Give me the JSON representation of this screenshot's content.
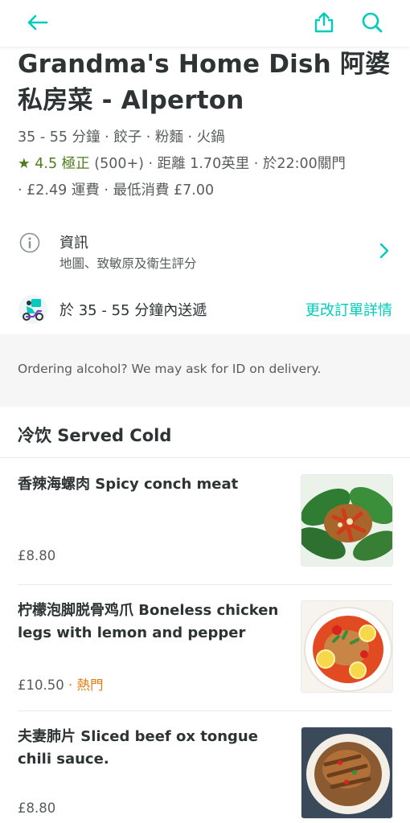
{
  "nav": {
    "back_icon": "arrow-left-icon",
    "share_icon": "share-icon",
    "search_icon": "search-icon",
    "accent": "#00ccbc"
  },
  "restaurant": {
    "title_line1": "Grandma's Home Dish 阿婆",
    "title_line2": "私房菜 - Alperton",
    "line1": "35 - 55 分鐘 · 餃子 · 粉麵 · 火鍋",
    "rating": "4.5 極正",
    "line2_rest": "(500+) · 距離 1.70英里 · 於22:00關門",
    "line3": "· £2.49 運費 · 最低消費 £7.00"
  },
  "info": {
    "title": "資訊",
    "subtitle": "地圖、致敏原及衛生評分"
  },
  "delivery": {
    "text": "於 35 - 55 分鐘內送遞",
    "link": "更改訂單詳情"
  },
  "notice": {
    "text": "Ordering alcohol? We may ask for ID on delivery."
  },
  "section": {
    "title": "冷饮 Served Cold"
  },
  "items": [
    {
      "name": "香辣海螺肉 Spicy conch meat",
      "price": "£8.80",
      "tag": ""
    },
    {
      "name": "柠檬泡脚脱骨鸡爪 Boneless chicken legs with lemon and pepper",
      "price": "£10.50",
      "tag": " · 熱門"
    },
    {
      "name": "夫妻肺片 Sliced beef ox tongue chili sauce.",
      "price": "£8.80",
      "tag": ""
    }
  ]
}
